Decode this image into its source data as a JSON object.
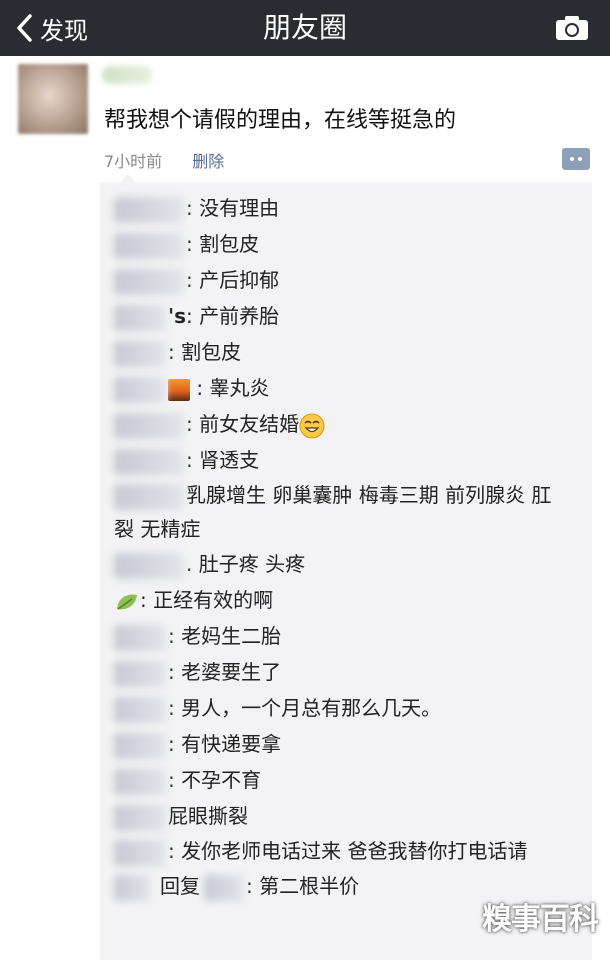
{
  "nav": {
    "back_label": "发现",
    "title": "朋友圈"
  },
  "post": {
    "text": "帮我想个请假的理由，在线等挺急的",
    "time": "7小时前",
    "delete_label": "删除"
  },
  "comments": [
    {
      "text": ": 没有理由"
    },
    {
      "text": ": 割包皮"
    },
    {
      "text": ": 产后抑郁"
    },
    {
      "name_tail": "'s",
      "text": ": 产前养胎"
    },
    {
      "text": ": 割包皮"
    },
    {
      "text": ": 睾丸炎"
    },
    {
      "text": ": 前女友结婚"
    },
    {
      "text": ": 肾透支"
    },
    {
      "text": "乳腺增生  卵巢囊肿  梅毒三期  前列腺炎  肛裂  无精症"
    },
    {
      "text": ". 肚子疼 头疼"
    },
    {
      "text": ": 正经有效的啊"
    },
    {
      "text": ": 老妈生二胎"
    },
    {
      "text": ": 老婆要生了"
    },
    {
      "text": ": 男人，一个月总有那么几天。"
    },
    {
      "text": ": 有快递要拿"
    },
    {
      "text": ": 不孕不育"
    },
    {
      "text": "屁眼撕裂"
    },
    {
      "text": ": 发你老师电话过来 爸爸我替你打电话请"
    },
    {
      "reply_word": "回复",
      "text": ": 第二根半价"
    }
  ],
  "watermark": "糗事百科",
  "icons": {
    "back": "chevron-left-icon",
    "camera": "camera-icon",
    "action": "comment-action-icon"
  },
  "colors": {
    "navbar": "#2b2c31",
    "link": "#576b95",
    "comment_bg": "#f3f3f5"
  }
}
